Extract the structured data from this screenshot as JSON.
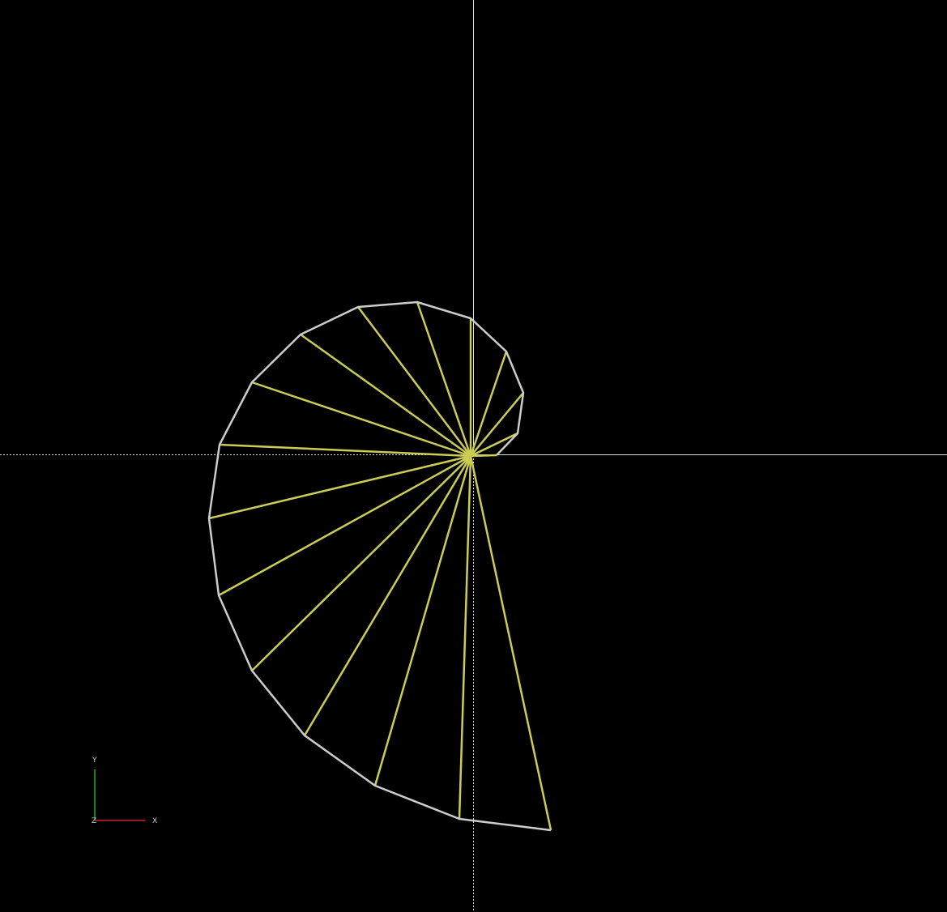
{
  "viewport": {
    "background": "#000000"
  },
  "colors": {
    "crosshair": "#dddddd",
    "outline": "#cccccc",
    "spokes": "#cccc55",
    "x_axis": "#cc2222",
    "y_axis": "#22aa22",
    "axis_label": "#cccccc"
  },
  "axis_indicator": {
    "x_label": "X",
    "y_label": "Y",
    "z_label": "Z"
  },
  "shape": {
    "description_type": "spiral-triangle-fan",
    "outline_points_count": 19
  }
}
